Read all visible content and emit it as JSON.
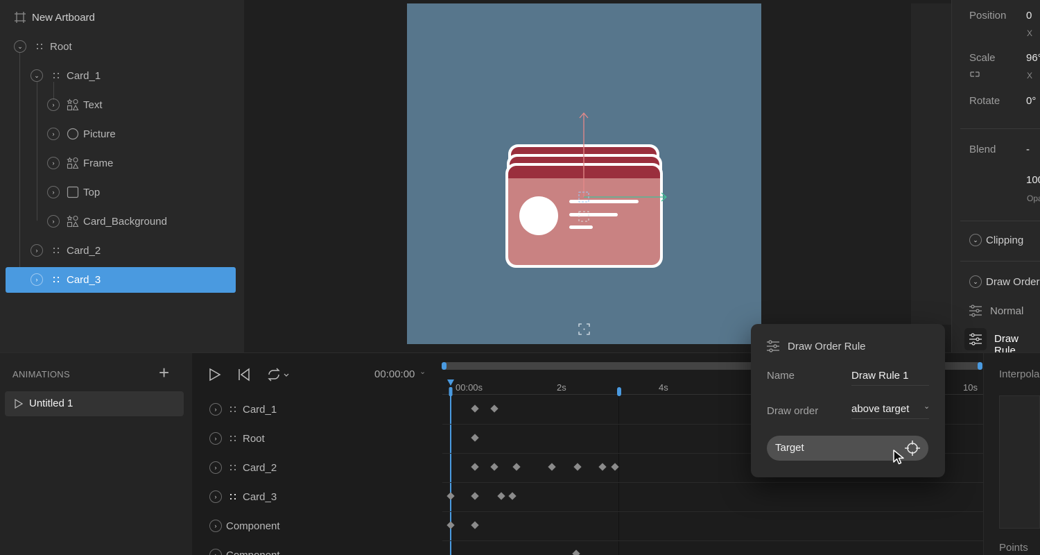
{
  "hierarchy": {
    "artboard_label": "New Artboard",
    "root": "Root",
    "card1": "Card_1",
    "children": [
      "Text",
      "Picture",
      "Frame",
      "Top",
      "Card_Background"
    ],
    "card2": "Card_2",
    "card3": "Card_3",
    "child_icons": [
      "shapes-icon",
      "ellipse-icon",
      "shapes-icon",
      "rectangle-icon",
      "shapes-icon"
    ]
  },
  "inspector": {
    "position_label": "Position",
    "position_value": "0",
    "position_axis": "X",
    "scale_label": "Scale",
    "scale_value": "96°",
    "scale_axis": "X",
    "rotate_label": "Rotate",
    "rotate_value": "0°",
    "blend_label": "Blend",
    "blend_value": "-",
    "opacity_value": "100",
    "opacity_label": "Opa",
    "clipping_label": "Clipping",
    "draw_order_label": "Draw Order",
    "normal_label": "Normal",
    "draw_rule_label": "Draw Rule"
  },
  "animations": {
    "header": "ANIMATIONS",
    "add_label": "+",
    "items": [
      "Untitled 1"
    ]
  },
  "timeline": {
    "timecode": "00:00:00",
    "ticks": [
      "00:00s",
      "2s",
      "4s",
      "10s"
    ],
    "rows": [
      "Card_1",
      "Root",
      "Card_2",
      "Card_3",
      "Component",
      "Component"
    ],
    "interpolation_label": "Interpola",
    "points_label": "Points"
  },
  "popup": {
    "title": "Draw Order Rule",
    "name_label": "Name",
    "name_value": "Draw Rule 1",
    "order_label": "Draw order",
    "order_value": "above target",
    "target_label": "Target"
  },
  "colors": {
    "accent": "#4a9ae0",
    "artboard": "#57768c",
    "card": "#c98282",
    "card_header": "#9a2f3d",
    "panel": "#282828"
  }
}
